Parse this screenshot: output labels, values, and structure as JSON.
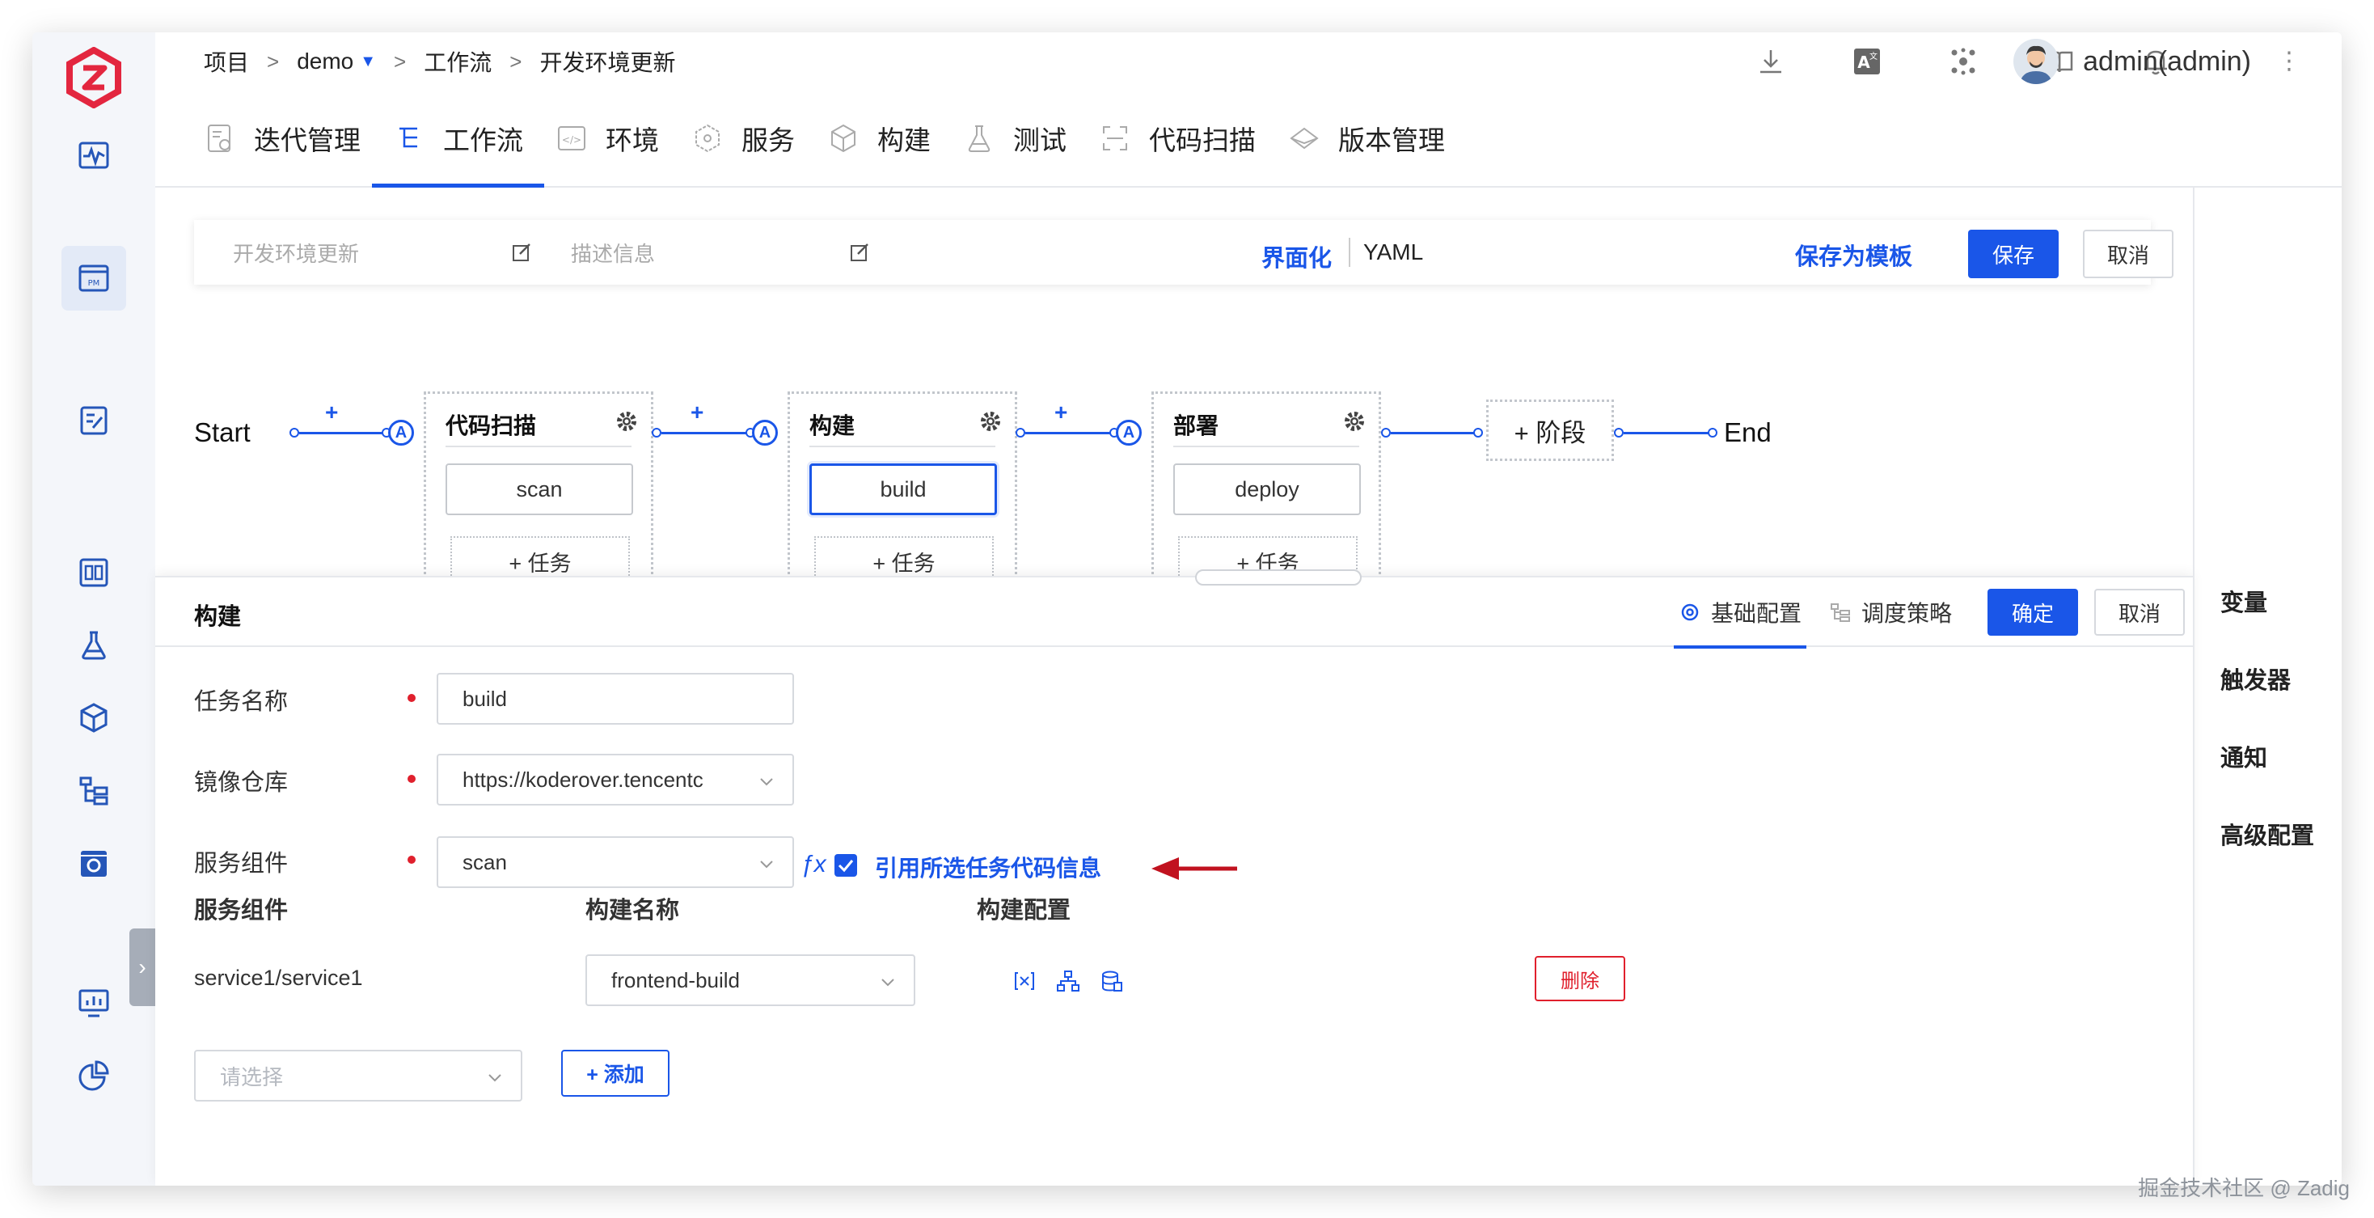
{
  "breadcrumb": {
    "items": [
      "项目",
      "demo",
      "工作流",
      "开发环境更新"
    ],
    "separator": ">"
  },
  "user": {
    "name": "admin(admin)"
  },
  "nav": {
    "tabs": [
      "迭代管理",
      "工作流",
      "环境",
      "服务",
      "构建",
      "测试",
      "代码扫描",
      "版本管理"
    ],
    "active": "工作流"
  },
  "editbar": {
    "name_placeholder": "开发环境更新",
    "desc_placeholder": "描述信息",
    "mode_ui": "界面化",
    "mode_yaml": "YAML",
    "save_template": "保存为模板",
    "save": "保存",
    "cancel": "取消"
  },
  "workflow": {
    "start": "Start",
    "end": "End",
    "plus": "+",
    "approval_mark": "A",
    "add_stage": "+ 阶段",
    "add_task": "+ 任务",
    "stages": [
      {
        "name": "代码扫描",
        "job": "scan"
      },
      {
        "name": "构建",
        "job": "build",
        "selected": true
      },
      {
        "name": "部署",
        "job": "deploy"
      }
    ]
  },
  "panel": {
    "title": "构建",
    "tabs": [
      "基础配置",
      "调度策略"
    ],
    "active_tab": "基础配置",
    "confirm": "确定",
    "cancel": "取消",
    "fields": {
      "task_name_label": "任务名称",
      "task_name_value": "build",
      "registry_label": "镜像仓库",
      "registry_value": "https://koderover.tencentc",
      "service_label": "服务组件",
      "service_value": "scan",
      "use_code_info_label": "引用所选任务代码信息",
      "use_code_info_checked": true
    },
    "table": {
      "headers": [
        "服务组件",
        "构建名称",
        "构建配置"
      ],
      "rows": [
        {
          "service": "service1/service1",
          "build": "frontend-build",
          "delete": "删除"
        }
      ]
    },
    "add_select_placeholder": "请选择",
    "add_button": "+ 添加"
  },
  "right_panel": {
    "items": [
      "变量",
      "触发器",
      "通知",
      "高级配置"
    ]
  },
  "watermark": "掘金技术社区 @ Zadig",
  "colors": {
    "accent": "#1a56e8",
    "danger": "#e0202d",
    "brand": "#e3263f"
  }
}
